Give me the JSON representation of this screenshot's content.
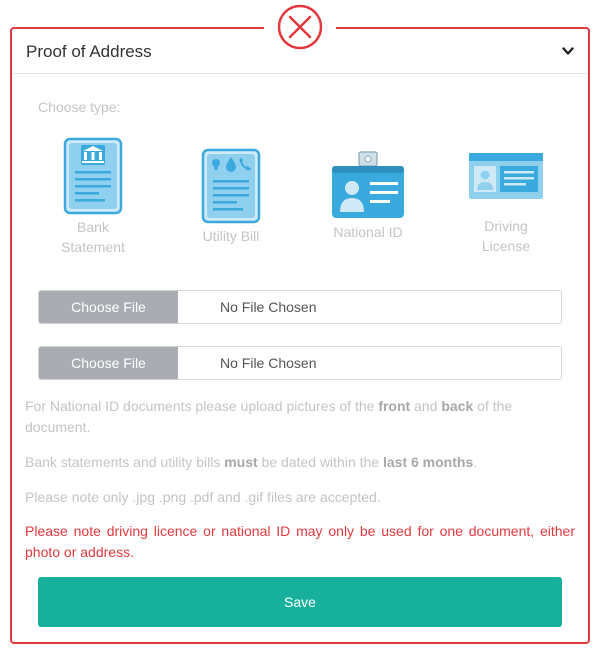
{
  "modal": {
    "title": "Proof of Address",
    "close_icon": "close-circle-icon",
    "accent_color": "#e0393e"
  },
  "choose_type_label": "Choose type:",
  "doc_types": [
    {
      "label": "Bank Statement",
      "icon": "bank-statement-icon",
      "selected": true
    },
    {
      "label": "Utility Bill",
      "icon": "utility-bill-icon",
      "selected": false
    },
    {
      "label": "National ID",
      "icon": "national-id-icon",
      "selected": false
    },
    {
      "label": "Driving License",
      "icon": "driving-license-icon",
      "selected": false
    }
  ],
  "file_inputs": [
    {
      "button_label": "Choose File",
      "status": "No File Chosen"
    },
    {
      "button_label": "Choose File",
      "status": "No File Chosen"
    }
  ],
  "notes": {
    "national_id": {
      "part1": "For National ID documents please upload pictures of the ",
      "front": "front",
      "part2": " and ",
      "back": "back",
      "part3": " of the document."
    },
    "dated": {
      "part1": "Bank statements and utility bills ",
      "must": "must",
      "part2": " be dated within the ",
      "last": "last 6 months",
      "part3": "."
    },
    "formats": "Please note only .jpg .png .pdf and .gif files are accepted.",
    "warning": "Please note driving licence or national ID may only be used for one document, either photo or address."
  },
  "save_label": "Save",
  "colors": {
    "primary": "#17b09d",
    "icon_blue": "#3aa9dd",
    "warning": "#e0393e"
  }
}
